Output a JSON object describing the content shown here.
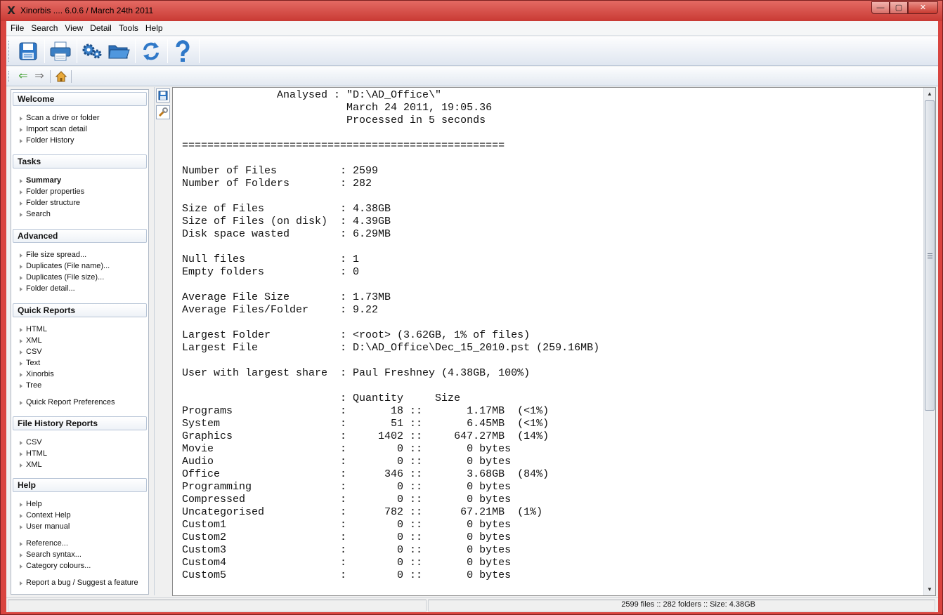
{
  "window": {
    "title": "Xinorbis .... 6.0.6 / March 24th 2011",
    "app_icon": "X",
    "minimize": "—",
    "maximize": "▢",
    "close": "✕"
  },
  "menu": [
    "File",
    "Search",
    "View",
    "Detail",
    "Tools",
    "Help"
  ],
  "toolbar": {
    "icons": [
      "save-icon",
      "print-icon",
      "settings-icon",
      "open-folder-icon",
      "refresh-icon",
      "help-icon"
    ]
  },
  "nav": {
    "icons": [
      "back-arrow-icon",
      "forward-arrow-icon",
      "home-icon"
    ]
  },
  "sidebar": {
    "sections": [
      {
        "title": "Welcome",
        "items": [
          "Scan a drive or folder",
          "Import scan detail",
          "Folder History"
        ]
      },
      {
        "title": "Tasks",
        "items": [
          "Summary",
          "Folder properties",
          "Folder structure",
          "Search"
        ]
      },
      {
        "title": "Advanced",
        "items": [
          "File size spread...",
          "Duplicates (File name)...",
          "Duplicates (File size)...",
          "Folder detail..."
        ]
      },
      {
        "title": "Quick Reports",
        "items": [
          "HTML",
          "XML",
          "CSV",
          "Text",
          "Xinorbis",
          "Tree",
          "Quick Report Preferences"
        ]
      },
      {
        "title": "File History Reports",
        "items": [
          "CSV",
          "HTML",
          "XML"
        ]
      },
      {
        "title": "Help",
        "items": [
          "Help",
          "Context Help",
          "User manual",
          "Reference...",
          "Search syntax...",
          "Category colours...",
          "Report a bug / Suggest a feature"
        ]
      }
    ]
  },
  "report": {
    "lines": [
      "               Analysed : \"D:\\AD_Office\\\"",
      "                          March 24 2011, 19:05.36",
      "                          Processed in 5 seconds",
      "",
      "===================================================",
      "",
      "Number of Files          : 2599",
      "Number of Folders        : 282",
      "",
      "Size of Files            : 4.38GB",
      "Size of Files (on disk)  : 4.39GB",
      "Disk space wasted        : 6.29MB",
      "",
      "Null files               : 1",
      "Empty folders            : 0",
      "",
      "Average File Size        : 1.73MB",
      "Average Files/Folder     : 9.22",
      "",
      "Largest Folder           : <root> (3.62GB, 1% of files)",
      "Largest File             : D:\\AD_Office\\Dec_15_2010.pst (259.16MB)",
      "",
      "User with largest share  : Paul Freshney (4.38GB, 100%)",
      "",
      "                         : Quantity     Size",
      "Programs                 :       18 ::       1.17MB  (<1%)",
      "System                   :       51 ::       6.45MB  (<1%)",
      "Graphics                 :     1402 ::     647.27MB  (14%)",
      "Movie                    :        0 ::       0 bytes",
      "Audio                    :        0 ::       0 bytes",
      "Office                   :      346 ::       3.68GB  (84%)",
      "Programming              :        0 ::       0 bytes",
      "Compressed               :        0 ::       0 bytes",
      "Uncategorised            :      782 ::      67.21MB  (1%)",
      "Custom1                  :        0 ::       0 bytes",
      "Custom2                  :        0 ::       0 bytes",
      "Custom3                  :        0 ::       0 bytes",
      "Custom4                  :        0 ::       0 bytes",
      "Custom5                  :        0 ::       0 bytes"
    ]
  },
  "status": {
    "summary": "2599 files  ::  282 folders  ::  Size: 4.38GB"
  }
}
